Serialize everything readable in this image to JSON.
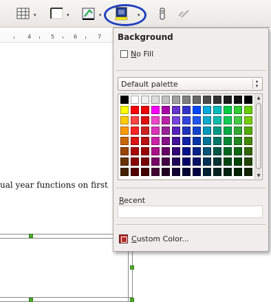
{
  "toolbar": {
    "icons": [
      "table-icon",
      "borders-icon",
      "border-style-icon",
      "background-color-icon",
      "vertical-align-icon",
      "table-options-icon"
    ],
    "dropdown_glyph": "▾"
  },
  "ruler": {
    "numbers": [
      "4",
      "5",
      "6",
      "7"
    ]
  },
  "document": {
    "text": "ual year functions on first"
  },
  "popup": {
    "title": "Background",
    "no_fill_prefix": "N",
    "no_fill_rest": "o Fill",
    "palette_name": "Default palette",
    "recent_prefix": "R",
    "recent_rest": "ecent",
    "custom_prefix": "C",
    "custom_rest": "ustom Color...",
    "colors": [
      [
        "#000000",
        "#ffffff",
        "#eeeeee",
        "#dddddd",
        "#c0c0c0",
        "#a0a0a0",
        "#808080",
        "#666666",
        "#4c4c4c",
        "#333333",
        "#1c1c1c",
        "#111111",
        "#000000"
      ],
      [
        "#ffff00",
        "#ff0000",
        "#ee0000",
        "#ff00ff",
        "#aa00aa",
        "#6633cc",
        "#3333cc",
        "#0047ff",
        "#00aadd",
        "#00bbbb",
        "#00cc44",
        "#33cc33",
        "#66cc00"
      ],
      [
        "#ffcc00",
        "#ff4444",
        "#dd1111",
        "#ee44cc",
        "#bb22aa",
        "#7744dd",
        "#3344dd",
        "#2255ee",
        "#11aacc",
        "#11bbaa",
        "#11cc55",
        "#44cc44",
        "#77cc11"
      ],
      [
        "#ff9900",
        "#ff2222",
        "#cc2222",
        "#dd33bb",
        "#992299",
        "#5522bb",
        "#2233bb",
        "#1144cc",
        "#0099bb",
        "#009988",
        "#00aa44",
        "#33aa33",
        "#55aa00"
      ],
      [
        "#cc6600",
        "#dd1111",
        "#bb1111",
        "#cc22aa",
        "#881188",
        "#441199",
        "#1122aa",
        "#0033aa",
        "#007799",
        "#007766",
        "#008833",
        "#228822",
        "#448800"
      ],
      [
        "#994400",
        "#aa0000",
        "#990000",
        "#aa1188",
        "#660066",
        "#330077",
        "#001188",
        "#002288",
        "#005577",
        "#005544",
        "#006622",
        "#116611",
        "#336600"
      ],
      [
        "#663300",
        "#880000",
        "#770000",
        "#770066",
        "#440044",
        "#220055",
        "#000066",
        "#001166",
        "#003355",
        "#003333",
        "#004411",
        "#004400",
        "#224400"
      ],
      [
        "#442200",
        "#550000",
        "#440000",
        "#440033",
        "#220022",
        "#110033",
        "#000033",
        "#000044",
        "#002233",
        "#002222",
        "#002211",
        "#002200",
        "#112200"
      ]
    ]
  }
}
